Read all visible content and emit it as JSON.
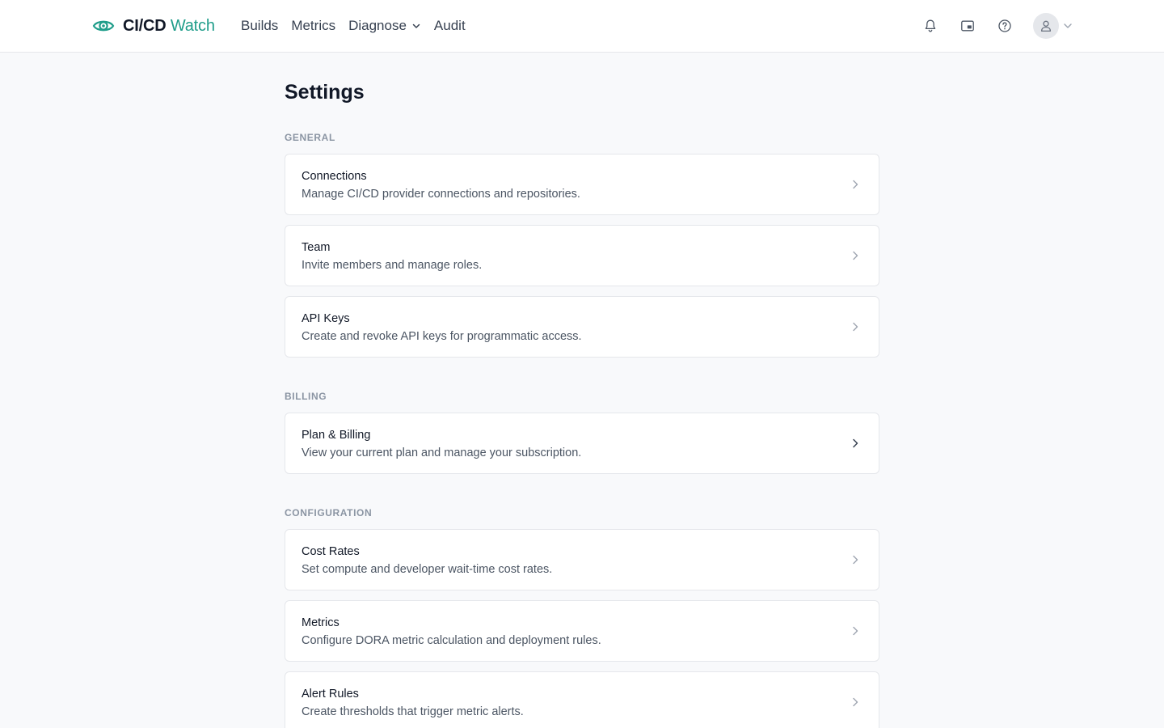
{
  "brand": {
    "name_strong": "CI/CD",
    "name_light": "Watch",
    "accent_color": "#1f9d8a",
    "logo_icon": "eye-icon"
  },
  "nav": {
    "items": [
      {
        "label": "Builds"
      },
      {
        "label": "Metrics"
      },
      {
        "label": "Diagnose",
        "has_dropdown": true
      },
      {
        "label": "Audit"
      }
    ]
  },
  "header_actions": {
    "icons": [
      "bell-icon",
      "picture-in-picture-icon",
      "help-circle-icon",
      "user-icon"
    ]
  },
  "page": {
    "title": "Settings"
  },
  "sections": [
    {
      "label": "General",
      "cards": [
        {
          "title": "Connections",
          "description": "Manage CI/CD provider connections and repositories."
        },
        {
          "title": "Team",
          "description": "Invite members and manage roles."
        },
        {
          "title": "API Keys",
          "description": "Create and revoke API keys for programmatic access."
        }
      ]
    },
    {
      "label": "Billing",
      "cards": [
        {
          "title": "Plan & Billing",
          "description": "View your current plan and manage your subscription."
        }
      ]
    },
    {
      "label": "Configuration",
      "cards": [
        {
          "title": "Cost Rates",
          "description": "Set compute and developer wait-time cost rates."
        },
        {
          "title": "Metrics",
          "description": "Configure DORA metric calculation and deployment rules."
        },
        {
          "title": "Alert Rules",
          "description": "Create thresholds that trigger metric alerts."
        }
      ]
    }
  ]
}
